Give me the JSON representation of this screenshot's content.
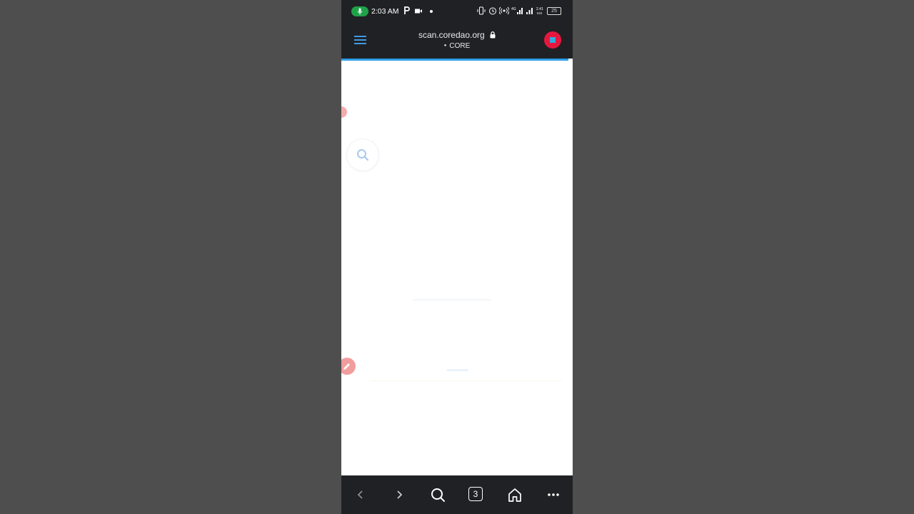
{
  "status_bar": {
    "time": "2:03 AM",
    "battery": "25",
    "icons": [
      "mic-icon",
      "parking-icon",
      "video-icon",
      "dot-icon",
      "vibrate-icon",
      "alarm-icon",
      "hotspot-icon",
      "signal-icon",
      "signal-icon",
      "speed-icon",
      "battery-icon"
    ]
  },
  "browser": {
    "url": "scan.coredao.org",
    "site_tag": "CORE",
    "tab_count": "3",
    "accent_color": "#2e9ee6"
  },
  "page": {
    "floating_buttons": [
      "search-icon",
      "edit-icon"
    ]
  },
  "nav": {
    "buttons": [
      "back-icon",
      "forward-icon",
      "search-icon",
      "tabs-icon",
      "home-icon",
      "more-icon"
    ]
  }
}
